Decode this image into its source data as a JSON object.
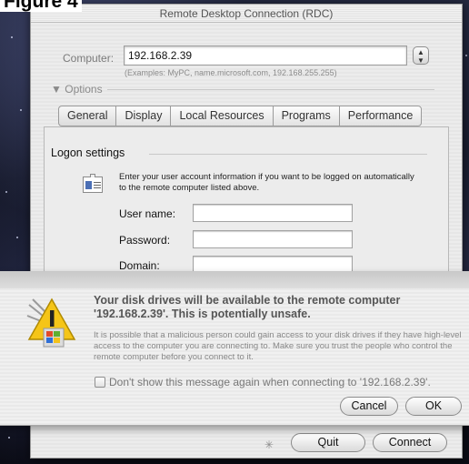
{
  "figure_caption": "Figure 4",
  "window": {
    "title": "Remote Desktop Connection (RDC)"
  },
  "computer": {
    "label": "Computer:",
    "value": "192.168.2.39",
    "examples": "(Examples: MyPC, name.microsoft.com, 192.168.255.255)"
  },
  "options_label": "Options",
  "tabs": [
    {
      "label": "General",
      "selected": true
    },
    {
      "label": "Display",
      "selected": false
    },
    {
      "label": "Local Resources",
      "selected": false
    },
    {
      "label": "Programs",
      "selected": false
    },
    {
      "label": "Performance",
      "selected": false
    }
  ],
  "logon": {
    "title": "Logon settings",
    "description": "Enter your user account information if you want to be logged on automatically to the remote computer listed above.",
    "user_name_label": "User name:",
    "password_label": "Password:",
    "domain_label": "Domain:"
  },
  "warning": {
    "heading": "Your disk drives will be available to the remote computer '192.168.2.39'.  This is potentially unsafe.",
    "body": "It is possible that a malicious person could gain access to your disk drives if they have high-level access to the computer you are connecting to.  Make sure you trust the people who control the remote computer before you connect to it.",
    "checkbox_label": "Don't show this message again when connecting to '192.168.2.39'.",
    "cancel_label": "Cancel",
    "ok_label": "OK"
  },
  "footer": {
    "quit_label": "Quit",
    "connect_label": "Connect"
  }
}
